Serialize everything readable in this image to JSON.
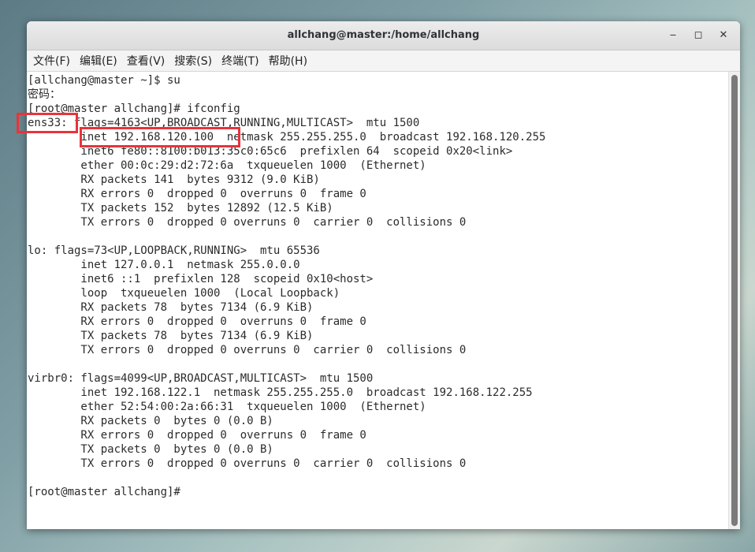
{
  "window": {
    "title": "allchang@master:/home/allchang"
  },
  "window_controls": {
    "minimize": "‒",
    "maximize": "◻",
    "close": "✕"
  },
  "menu": [
    {
      "label": "文件(F)"
    },
    {
      "label": "编辑(E)"
    },
    {
      "label": "查看(V)"
    },
    {
      "label": "搜索(S)"
    },
    {
      "label": "终端(T)"
    },
    {
      "label": "帮助(H)"
    }
  ],
  "terminal": {
    "lines": [
      "[allchang@master ~]$ su",
      "密码：",
      "[root@master allchang]# ifconfig",
      "ens33: flags=4163<UP,BROADCAST,RUNNING,MULTICAST>  mtu 1500",
      "        inet 192.168.120.100  netmask 255.255.255.0  broadcast 192.168.120.255",
      "        inet6 fe80::8100:b013:35c0:65c6  prefixlen 64  scopeid 0x20<link>",
      "        ether 00:0c:29:d2:72:6a  txqueuelen 1000  (Ethernet)",
      "        RX packets 141  bytes 9312 (9.0 KiB)",
      "        RX errors 0  dropped 0  overruns 0  frame 0",
      "        TX packets 152  bytes 12892 (12.5 KiB)",
      "        TX errors 0  dropped 0 overruns 0  carrier 0  collisions 0",
      "",
      "lo: flags=73<UP,LOOPBACK,RUNNING>  mtu 65536",
      "        inet 127.0.0.1  netmask 255.0.0.0",
      "        inet6 ::1  prefixlen 128  scopeid 0x10<host>",
      "        loop  txqueuelen 1000  (Local Loopback)",
      "        RX packets 78  bytes 7134 (6.9 KiB)",
      "        RX errors 0  dropped 0  overruns 0  frame 0",
      "        TX packets 78  bytes 7134 (6.9 KiB)",
      "        TX errors 0  dropped 0 overruns 0  carrier 0  collisions 0",
      "",
      "virbr0: flags=4099<UP,BROADCAST,MULTICAST>  mtu 1500",
      "        inet 192.168.122.1  netmask 255.255.255.0  broadcast 192.168.122.255",
      "        ether 52:54:00:2a:66:31  txqueuelen 1000  (Ethernet)",
      "        RX packets 0  bytes 0 (0.0 B)",
      "        RX errors 0  dropped 0  overruns 0  frame 0",
      "        TX packets 0  bytes 0 (0.0 B)",
      "        TX errors 0  dropped 0 overruns 0  carrier 0  collisions 0",
      "",
      "[root@master allchang]# "
    ]
  },
  "colors": {
    "highlight": "#e8343a",
    "terminal_bg": "#ffffff",
    "terminal_fg": "#2b2b2b"
  }
}
